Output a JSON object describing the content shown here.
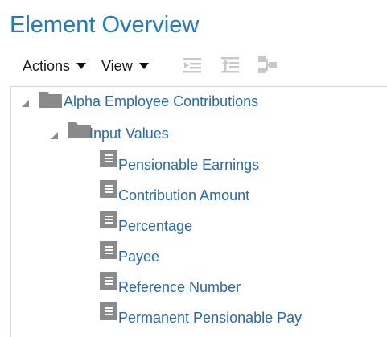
{
  "page": {
    "title": "Element Overview"
  },
  "toolbar": {
    "actions_label": "Actions",
    "view_label": "View",
    "icons": [
      "expand-all-icon",
      "collapse-all-icon",
      "hierarchy-icon"
    ]
  },
  "tree": {
    "root": {
      "label": "Alpha Employee Contributions",
      "expanded": true,
      "icon": "folder-icon"
    },
    "group": {
      "label": "Input Values",
      "expanded": true,
      "icon": "folder-icon"
    },
    "items": [
      {
        "label": "Pensionable Earnings",
        "icon": "document-icon"
      },
      {
        "label": "Contribution Amount",
        "icon": "document-icon"
      },
      {
        "label": "Percentage",
        "icon": "document-icon"
      },
      {
        "label": "Payee",
        "icon": "document-icon"
      },
      {
        "label": "Reference Number",
        "icon": "document-icon"
      },
      {
        "label": "Permanent Pensionable Pay",
        "icon": "document-icon"
      }
    ]
  },
  "colors": {
    "title": "#1f7bc6",
    "link": "#2468b3",
    "icon_gray": "#8a8a8a",
    "toolbar_icon_disabled": "#c8c8c8"
  }
}
